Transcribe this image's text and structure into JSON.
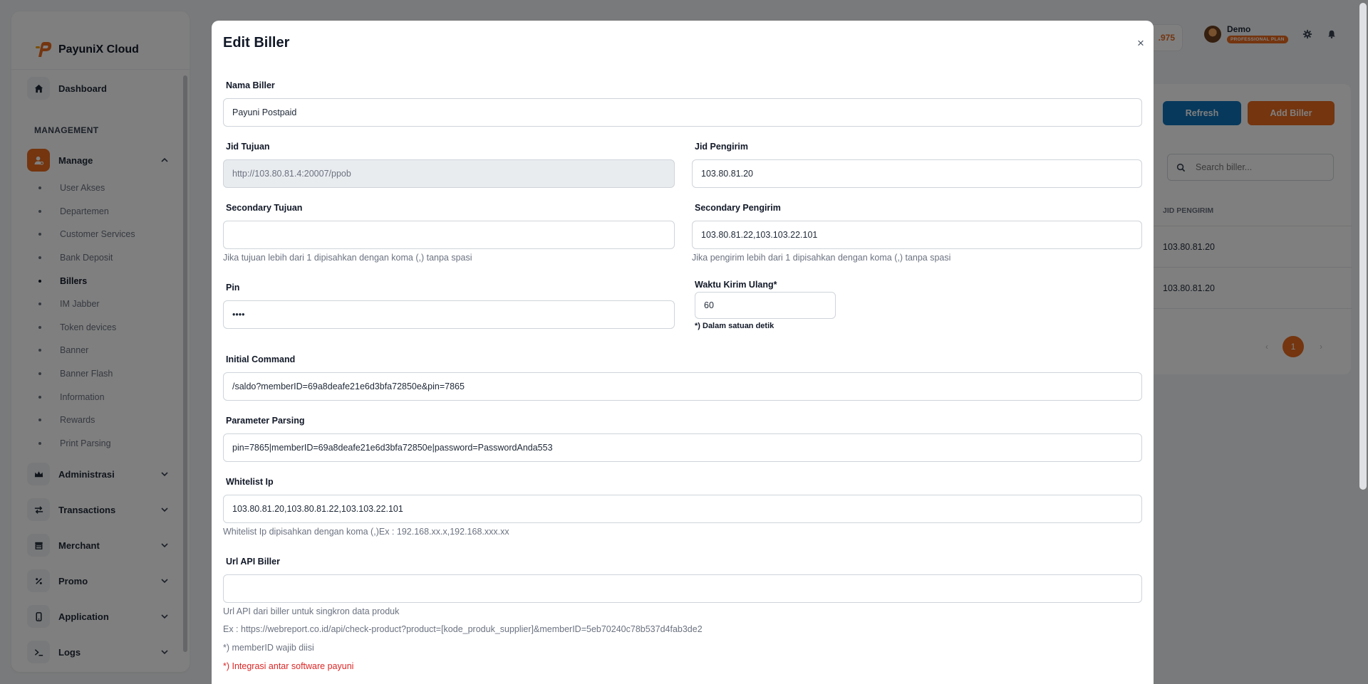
{
  "brand": {
    "name": "PayuniX Cloud"
  },
  "sidebar": {
    "dashboard_label": "Dashboard",
    "section_label": "MANAGEMENT",
    "manage_label": "Manage",
    "manage_items": [
      "User Akses",
      "Departemen",
      "Customer Services",
      "Bank Deposit",
      "Billers",
      "IM Jabber",
      "Token devices",
      "Banner",
      "Banner Flash",
      "Information",
      "Rewards",
      "Print Parsing"
    ],
    "active_item": "Billers",
    "groups": [
      "Administrasi",
      "Transactions",
      "Merchant",
      "Promo",
      "Application",
      "Logs"
    ]
  },
  "topbar": {
    "balance_fragment": ".975",
    "user_name": "Demo",
    "plan": "PROFESSIONAL PLAN"
  },
  "background_page": {
    "refresh_label": "Refresh",
    "add_label": "Add Biller",
    "search_placeholder": "Search biller...",
    "column_header": "JID PENGIRIM",
    "rows": [
      "103.80.81.20",
      "103.80.81.20"
    ],
    "current_page": "1"
  },
  "modal": {
    "title": "Edit Biller",
    "close": "×",
    "nama_biller": {
      "label": "Nama Biller",
      "value": "Payuni Postpaid"
    },
    "jid_tujuan": {
      "label": "Jid Tujuan",
      "value": "http://103.80.81.4:20007/ppob"
    },
    "jid_pengirim": {
      "label": "Jid Pengirim",
      "value": "103.80.81.20"
    },
    "secondary_tujuan": {
      "label": "Secondary Tujuan",
      "value": "",
      "hint": "Jika tujuan lebih dari 1 dipisahkan dengan koma (,) tanpa spasi"
    },
    "secondary_pengirim": {
      "label": "Secondary Pengirim",
      "value": "103.80.81.22,103.103.22.101",
      "hint": "Jika pengirim lebih dari 1 dipisahkan dengan koma (,) tanpa spasi"
    },
    "pin": {
      "label": "Pin",
      "value": "••••"
    },
    "waktu_kirim": {
      "label": "Waktu Kirim Ulang*",
      "value": "60",
      "note": "*) Dalam satuan detik"
    },
    "initial_command": {
      "label": "Initial Command",
      "value": "/saldo?memberID=69a8deafe21e6d3bfa72850e&pin=7865"
    },
    "parameter_parsing": {
      "label": "Parameter Parsing",
      "value": "pin=7865|memberID=69a8deafe21e6d3bfa72850e|password=PasswordAnda553"
    },
    "whitelist_ip": {
      "label": "Whitelist Ip",
      "value": "103.80.81.20,103.80.81.22,103.103.22.101",
      "hint": "Whitelist Ip dipisahkan dengan koma (,)Ex : 192.168.xx.x,192.168.xxx.xx"
    },
    "url_api": {
      "label": "Url API Biller",
      "value": "",
      "hint1": "Url API dari biller untuk singkron data produk",
      "hint2": "Ex : https://webreport.co.id/api/check-product?product=[kode_produk_supplier]&memberID=5eb70240c78b537d4fab3de2",
      "hint3": "*) memberID wajib diisi",
      "hint4": "*) Integrasi antar software payuni"
    }
  }
}
